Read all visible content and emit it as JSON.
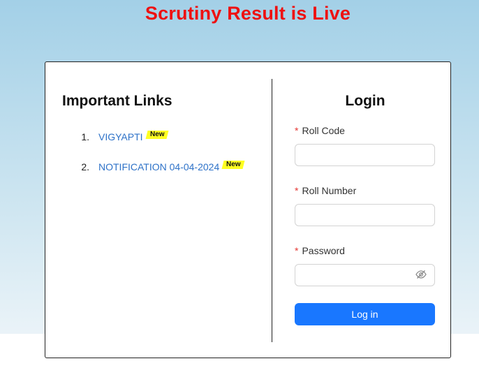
{
  "banner": {
    "text": "Scrutiny Result is Live"
  },
  "links": {
    "title": "Important Links",
    "items": [
      {
        "number": "1.",
        "label": "VIGYAPTI",
        "badge": "New"
      },
      {
        "number": "2.",
        "label": "NOTIFICATION 04-04-2024",
        "badge": "New"
      }
    ]
  },
  "login": {
    "title": "Login",
    "required_mark": "*",
    "roll_code": {
      "label": "Roll Code",
      "value": ""
    },
    "roll_number": {
      "label": "Roll Number",
      "value": ""
    },
    "password": {
      "label": "Password",
      "value": "",
      "toggle_icon": "eye-slash-icon"
    },
    "submit_label": "Log in"
  },
  "colors": {
    "banner": "#ee1111",
    "link": "#2e72c8",
    "badge_bg": "#ffff22",
    "primary_button": "#1977ff",
    "required": "#e53935"
  }
}
